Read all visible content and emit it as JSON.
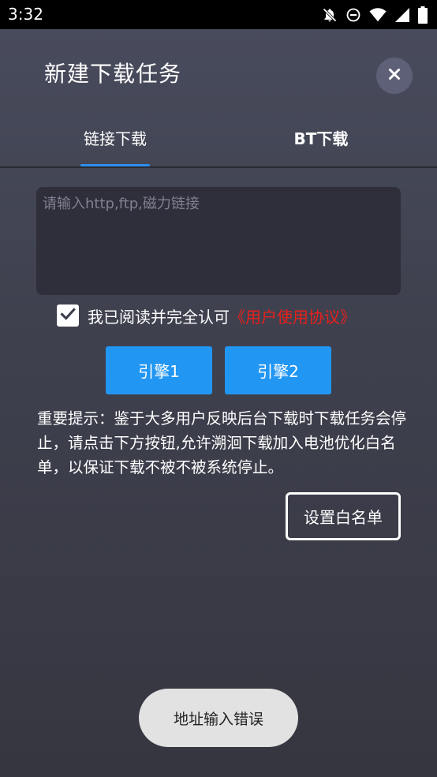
{
  "status_bar": {
    "time": "3:32",
    "icons": [
      "notifications-off-icon",
      "do-not-disturb-icon",
      "wifi-icon",
      "signal-icon",
      "battery-icon"
    ]
  },
  "dialog": {
    "title": "新建下载任务",
    "close_icon": "close-icon"
  },
  "tabs": [
    {
      "label": "链接下载",
      "active": true
    },
    {
      "label": "BT下载",
      "active": false
    }
  ],
  "url_input": {
    "value": "",
    "placeholder": "请输入http,ftp,磁力链接"
  },
  "agreement": {
    "checked": true,
    "text": "我已阅读并完全认可",
    "link_text": "《用户使用协议》"
  },
  "engines": [
    {
      "label": "引擎1"
    },
    {
      "label": "引擎2"
    }
  ],
  "notice": "重要提示：鉴于大多用户反映后台下载时下载任务会停止，请点击下方按钮,允许溯洄下载加入电池优化白名单，以保证下载不被不被系统停止。",
  "whitelist_button": "设置白名单",
  "toast": "地址输入错误",
  "colors": {
    "accent": "#2196f3",
    "tab_indicator": "#2e8ef0",
    "link": "#e8201c",
    "input_bg": "#2f2f3b"
  }
}
